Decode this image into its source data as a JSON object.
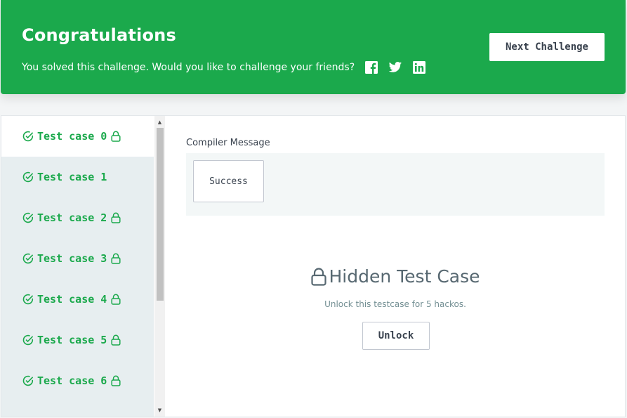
{
  "banner": {
    "title": "Congratulations",
    "subtitle": "You solved this challenge. Would you like to challenge your friends?",
    "share_icons": [
      "facebook-icon",
      "twitter-icon",
      "linkedin-icon"
    ],
    "next_button": "Next Challenge",
    "color": "#1ba94c"
  },
  "testcases": [
    {
      "label": "Test case 0",
      "locked": true,
      "passed": true,
      "active": true
    },
    {
      "label": "Test case 1",
      "locked": false,
      "passed": true,
      "active": false
    },
    {
      "label": "Test case 2",
      "locked": true,
      "passed": true,
      "active": false
    },
    {
      "label": "Test case 3",
      "locked": true,
      "passed": true,
      "active": false
    },
    {
      "label": "Test case 4",
      "locked": true,
      "passed": true,
      "active": false
    },
    {
      "label": "Test case 5",
      "locked": true,
      "passed": true,
      "active": false
    },
    {
      "label": "Test case 6",
      "locked": true,
      "passed": true,
      "active": false
    }
  ],
  "main": {
    "compiler_label": "Compiler Message",
    "compiler_value": "Success",
    "hidden_title": "Hidden Test Case",
    "hidden_subtitle": "Unlock this testcase for 5 hackos.",
    "unlock_button": "Unlock"
  }
}
